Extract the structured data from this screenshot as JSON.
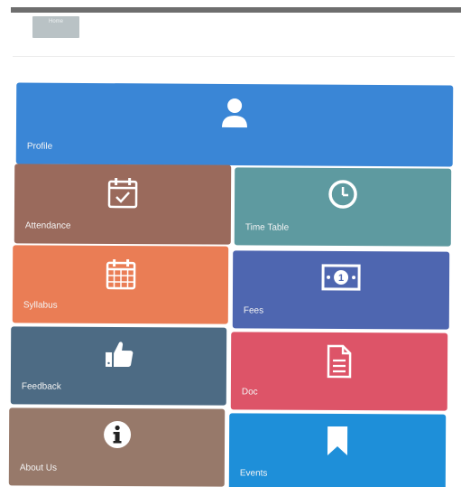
{
  "header": {
    "button_label": "Home"
  },
  "colors": {
    "profile": "#3a86d6",
    "attendance": "#9a6a5c",
    "timetable": "#5e9aa0",
    "syllabus": "#ea7d55",
    "fees": "#4e66b0",
    "feedback": "#4d6b84",
    "doc": "#dd5468",
    "about": "#97796a",
    "events": "#1e8fd9"
  },
  "tiles": [
    {
      "key": "profile",
      "label": "Profile",
      "icon": "user-icon"
    },
    {
      "key": "attendance",
      "label": "Attendance",
      "icon": "calendar-check-icon"
    },
    {
      "key": "timetable",
      "label": "Time Table",
      "icon": "clock-icon"
    },
    {
      "key": "syllabus",
      "label": "Syllabus",
      "icon": "calendar-grid-icon"
    },
    {
      "key": "fees",
      "label": "Fees",
      "icon": "money-icon"
    },
    {
      "key": "feedback",
      "label": "Feedback",
      "icon": "thumbs-up-icon"
    },
    {
      "key": "doc",
      "label": "Doc",
      "icon": "document-icon"
    },
    {
      "key": "about",
      "label": "About Us",
      "icon": "info-icon"
    },
    {
      "key": "events",
      "label": "Events",
      "icon": "bookmark-icon"
    }
  ]
}
